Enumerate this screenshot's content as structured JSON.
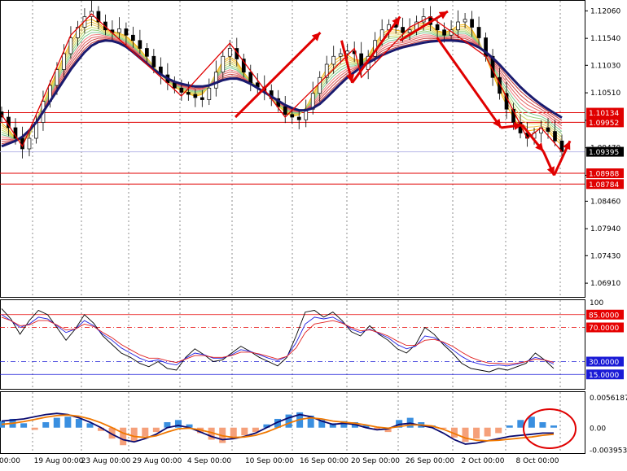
{
  "chart_data": [
    {
      "type": "line",
      "panel": "price",
      "y_ticks": [
        "1.12060",
        "1.11540",
        "1.11030",
        "1.10510",
        "1.09990",
        "1.09470",
        "1.08950",
        "1.08460",
        "1.07940",
        "1.07430",
        "1.06910"
      ],
      "ylim": [
        1.0665,
        1.1225
      ],
      "x_labels": [
        "00:00",
        "19 Aug 00:00",
        "23 Aug 00:00",
        "29 Aug 00:00",
        "4 Sep 00:00",
        "10 Sep 00:00",
        "16 Sep 00:00",
        "20 Sep 00:00",
        "26 Sep 00:00",
        "2 Oct 00:00",
        "8 Oct 00:00"
      ],
      "price_badges": [
        {
          "text": "1.10134",
          "value": 1.10134,
          "kind": "level"
        },
        {
          "text": "1.09952",
          "value": 1.09952,
          "kind": "level"
        },
        {
          "text": "1.09395",
          "value": 1.09395,
          "kind": "bid"
        },
        {
          "text": "1.08988",
          "value": 1.08988,
          "kind": "level"
        },
        {
          "text": "1.08784",
          "value": 1.08784,
          "kind": "level"
        }
      ],
      "close": [
        1.1005,
        1.0985,
        1.0965,
        1.0945,
        1.0965,
        1.0995,
        1.1035,
        1.1065,
        1.1095,
        1.1125,
        1.1155,
        1.1175,
        1.1195,
        1.1205,
        1.1185,
        1.117,
        1.1165,
        1.1172,
        1.116,
        1.115,
        1.1135,
        1.112,
        1.11,
        1.1085,
        1.107,
        1.106,
        1.1052,
        1.1048,
        1.1042,
        1.1038,
        1.106,
        1.109,
        1.112,
        1.1135,
        1.1115,
        1.109,
        1.107,
        1.1062,
        1.1055,
        1.104,
        1.1025,
        1.101,
        1.1005,
        1.1,
        1.102,
        1.105,
        1.108,
        1.1105,
        1.112,
        1.1125,
        1.113,
        1.1125,
        1.1095,
        1.112,
        1.115,
        1.117,
        1.118,
        1.1175,
        1.1165,
        1.117,
        1.1185,
        1.1195,
        1.118,
        1.117,
        1.116,
        1.117,
        1.1185,
        1.119,
        1.1175,
        1.1155,
        1.112,
        1.108,
        1.105,
        1.102,
        1.0995,
        1.0975,
        1.0965,
        1.0975,
        1.0985,
        1.0978,
        1.096,
        1.094
      ],
      "ma_slow": [
        1.095,
        1.0955,
        1.096,
        1.0968,
        1.098,
        1.0995,
        1.1015,
        1.1035,
        1.1055,
        1.1075,
        1.1095,
        1.1112,
        1.1128,
        1.114,
        1.1147,
        1.115,
        1.1149,
        1.1145,
        1.1138,
        1.1128,
        1.1117,
        1.1106,
        1.1095,
        1.1086,
        1.1078,
        1.1072,
        1.1068,
        1.1065,
        1.1063,
        1.1063,
        1.1065,
        1.107,
        1.1075,
        1.1078,
        1.1078,
        1.1074,
        1.1068,
        1.106,
        1.1052,
        1.1044,
        1.1036,
        1.1028,
        1.1022,
        1.1018,
        1.1018,
        1.1022,
        1.103,
        1.1042,
        1.1055,
        1.1068,
        1.108,
        1.109,
        1.11,
        1.1108,
        1.1115,
        1.1122,
        1.1128,
        1.1133,
        1.1137,
        1.114,
        1.1143,
        1.1146,
        1.1148,
        1.1149,
        1.115,
        1.115,
        1.1149,
        1.1147,
        1.1143,
        1.1137,
        1.1128,
        1.1117,
        1.1104,
        1.109,
        1.1076,
        1.1062,
        1.105,
        1.1039,
        1.1029,
        1.102,
        1.1012,
        1.1004
      ],
      "zigzag": [
        {
          "i": 0,
          "v": 1.101
        },
        {
          "i": 3,
          "v": 1.095
        },
        {
          "i": 10,
          "v": 1.116
        },
        {
          "i": 13,
          "v": 1.12
        },
        {
          "i": 26,
          "v": 1.1045
        },
        {
          "i": 33,
          "v": 1.1145
        },
        {
          "i": 41,
          "v": 1.1005
        },
        {
          "i": 51,
          "v": 1.1135
        },
        {
          "i": 52,
          "v": 1.108
        },
        {
          "i": 59,
          "v": 1.1175
        },
        {
          "i": 62,
          "v": 1.1195
        },
        {
          "i": 70,
          "v": 1.112
        },
        {
          "i": 76,
          "v": 1.0965
        },
        {
          "i": 78,
          "v": 1.0985
        },
        {
          "i": 81,
          "v": 1.094
        }
      ],
      "arrows": [
        {
          "from": [
            44,
            1.1005
          ],
          "to": [
            60,
            1.1165
          ]
        },
        {
          "from": [
            64,
            1.115
          ],
          "to": [
            66,
            1.107
          ]
        },
        {
          "from": [
            66,
            1.107
          ],
          "to": [
            75,
            1.1195
          ]
        },
        {
          "from": [
            75,
            1.115
          ],
          "to": [
            84,
            1.1205
          ]
        },
        {
          "from": [
            82,
            1.1155
          ],
          "to": [
            94,
            1.0985
          ]
        },
        {
          "from": [
            94,
            1.0985
          ],
          "to": [
            98,
            1.099
          ]
        },
        {
          "from": [
            98,
            1.099
          ],
          "to": [
            102,
            1.094
          ]
        },
        {
          "from": [
            102,
            1.094
          ],
          "to": [
            104,
            1.0895
          ]
        },
        {
          "from": [
            104,
            1.0895
          ],
          "to": [
            107,
            1.096
          ]
        }
      ]
    },
    {
      "type": "line",
      "panel": "oscillator",
      "ylim": [
        0,
        100
      ],
      "y_ticks": [
        "100"
      ],
      "levels": [
        {
          "value": 85,
          "text": "85.0000",
          "color": "#e60000"
        },
        {
          "value": 70,
          "text": "70.0000",
          "color": "#e60000"
        },
        {
          "value": 30,
          "text": "30.0000",
          "color": "#1a1ad6"
        },
        {
          "value": 15,
          "text": "15.0000",
          "color": "#1a1ad6"
        }
      ],
      "series": [
        {
          "color": "#000000",
          "values": [
            92,
            80,
            62,
            78,
            90,
            85,
            70,
            55,
            68,
            85,
            75,
            60,
            50,
            40,
            35,
            28,
            24,
            30,
            22,
            20,
            35,
            45,
            38,
            30,
            32,
            40,
            48,
            42,
            35,
            30,
            25,
            35,
            60,
            88,
            90,
            82,
            88,
            78,
            65,
            60,
            72,
            62,
            55,
            45,
            40,
            50,
            70,
            62,
            50,
            40,
            28,
            22,
            20,
            18,
            22,
            20,
            24,
            28,
            40,
            32,
            22
          ]
        },
        {
          "color": "#2020e0",
          "values": [
            85,
            78,
            70,
            74,
            82,
            80,
            72,
            64,
            68,
            78,
            72,
            62,
            55,
            46,
            40,
            34,
            30,
            32,
            28,
            26,
            34,
            40,
            38,
            34,
            34,
            38,
            44,
            42,
            38,
            34,
            31,
            36,
            52,
            74,
            82,
            80,
            82,
            76,
            68,
            64,
            68,
            63,
            58,
            50,
            45,
            48,
            60,
            58,
            52,
            44,
            36,
            30,
            27,
            25,
            26,
            25,
            27,
            30,
            35,
            32,
            27
          ]
        },
        {
          "color": "#e02020",
          "values": [
            82,
            78,
            72,
            73,
            78,
            78,
            73,
            67,
            68,
            74,
            71,
            64,
            58,
            50,
            44,
            38,
            34,
            34,
            31,
            29,
            33,
            37,
            37,
            35,
            35,
            37,
            41,
            41,
            39,
            36,
            33,
            36,
            46,
            64,
            74,
            76,
            78,
            75,
            70,
            66,
            67,
            64,
            60,
            54,
            49,
            49,
            55,
            56,
            53,
            48,
            41,
            35,
            31,
            28,
            28,
            27,
            28,
            30,
            33,
            32,
            29
          ]
        }
      ]
    },
    {
      "type": "bar",
      "panel": "macd",
      "ylim": [
        -0.0045,
        0.0062
      ],
      "y_ticks": [
        "0.0056187",
        "0.00",
        "-0.003953"
      ],
      "bars": [
        0.0012,
        0.0016,
        0.0008,
        -0.0004,
        0.001,
        0.0018,
        0.002,
        0.0016,
        0.0008,
        -0.0006,
        -0.002,
        -0.0032,
        -0.0026,
        -0.0016,
        -0.0008,
        0.001,
        0.0014,
        0.0006,
        -0.001,
        -0.0022,
        -0.0028,
        -0.002,
        -0.0014,
        -0.0008,
        0.0006,
        0.0016,
        0.0024,
        0.0028,
        0.0022,
        0.0014,
        0.0008,
        0.0012,
        0.001,
        0.0004,
        -0.0004,
        -0.0008,
        0.0014,
        0.0018,
        0.001,
        0.0004,
        -0.0002,
        -0.0018,
        -0.0026,
        -0.002,
        -0.0016,
        -0.001,
        0.0004,
        0.0014,
        0.002,
        0.001,
        0.0004
      ],
      "series": [
        {
          "color": "#0a0a70",
          "values": [
            0.0012,
            0.0014,
            0.0016,
            0.002,
            0.0024,
            0.0026,
            0.0024,
            0.0018,
            0.001,
            0.0,
            -0.0012,
            -0.0022,
            -0.0026,
            -0.002,
            -0.0012,
            0.0,
            0.0004,
            0.0,
            -0.0008,
            -0.0016,
            -0.0022,
            -0.002,
            -0.0016,
            -0.001,
            0.0,
            0.001,
            0.0018,
            0.0024,
            0.002,
            0.0012,
            0.0006,
            0.0008,
            0.0006,
            0.0,
            -0.0004,
            -0.0002,
            0.0006,
            0.0008,
            0.0004,
            0.0,
            -0.001,
            -0.0022,
            -0.003,
            -0.0028,
            -0.0024,
            -0.002,
            -0.0016,
            -0.0014,
            -0.0012,
            -0.001,
            -0.001
          ]
        },
        {
          "color": "#f07800",
          "values": [
            0.0006,
            0.0008,
            0.0011,
            0.0015,
            0.0019,
            0.0022,
            0.0023,
            0.0021,
            0.0016,
            0.0009,
            0.0,
            -0.001,
            -0.0016,
            -0.0018,
            -0.0015,
            -0.0008,
            -0.0002,
            -0.0001,
            -0.0004,
            -0.0009,
            -0.0015,
            -0.0018,
            -0.0017,
            -0.0014,
            -0.0008,
            0.0,
            0.0008,
            0.0015,
            0.0018,
            0.0016,
            0.0012,
            0.001,
            0.0008,
            0.0005,
            0.0001,
            -0.0001,
            0.0002,
            0.0005,
            0.0005,
            0.0003,
            -0.0003,
            -0.0011,
            -0.0019,
            -0.0023,
            -0.0024,
            -0.0023,
            -0.0021,
            -0.0019,
            -0.0017,
            -0.0014,
            -0.0012
          ]
        }
      ]
    }
  ]
}
